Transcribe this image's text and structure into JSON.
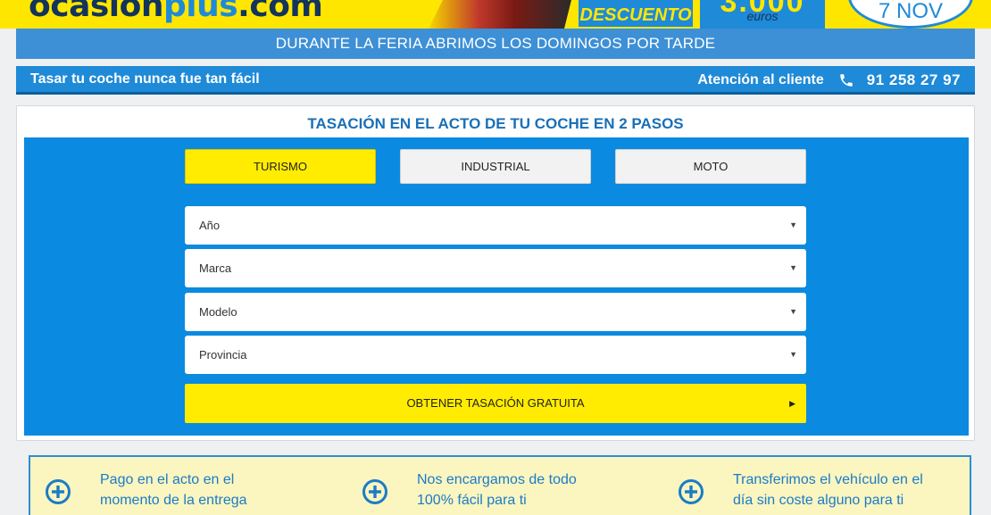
{
  "banner": {
    "logo_main": "ocasion",
    "logo_accent": "plus",
    "logo_suffix": ".com",
    "descuento": "DESCUENTO",
    "amount": "3.000",
    "currency": "euros",
    "date": "7 NOV"
  },
  "feria_text": "DURANTE LA FERIA ABRIMOS LOS DOMINGOS POR TARDE",
  "subheader": {
    "tagline": "Tasar tu coche nunca fue tan fácil",
    "support_label": "Atención al cliente",
    "phone": "91 258 27 97"
  },
  "form": {
    "title": "TASACIÓN EN EL ACTO DE TU COCHE EN 2 PASOS",
    "tabs": [
      "TURISMO",
      "INDUSTRIAL",
      "MOTO"
    ],
    "active_tab": "TURISMO",
    "selects": {
      "year": "Año",
      "brand": "Marca",
      "model": "Modelo",
      "province": "Provincia"
    },
    "submit": "OBTENER TASACIÓN GRATUITA"
  },
  "benefits": [
    {
      "line1": "Pago en el acto en el",
      "line2": "momento de la entrega"
    },
    {
      "line1": "Nos encargamos de todo",
      "line2": "100% fácil para ti"
    },
    {
      "line1": "Transferimos el vehículo en el",
      "line2": "día sin coste alguno para ti"
    }
  ],
  "colors": {
    "brand_yellow": "#ffe600",
    "brand_blue": "#1e8ad8",
    "panel_blue": "#0a8ae0",
    "navy": "#13345b"
  },
  "icons": [
    "phone-icon",
    "plus-circle-icon",
    "caret-down-icon",
    "caret-right-icon"
  ]
}
